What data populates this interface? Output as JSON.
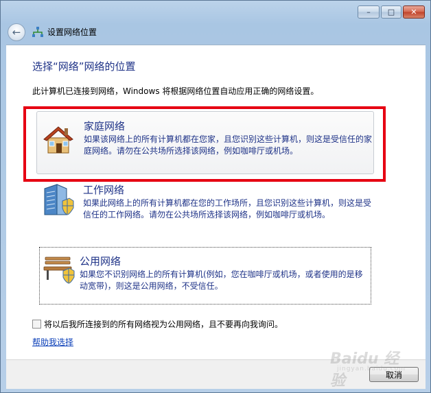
{
  "window": {
    "title": "设置网络位置",
    "controls": {
      "minimize": "–",
      "maximize": "□",
      "close": "✕"
    }
  },
  "content": {
    "heading": "选择“网络”网络的位置",
    "description": "此计算机已连接到网络，Windows 将根据网络位置自动应用正确的网络设置。",
    "options": [
      {
        "title": "家庭网络",
        "line1": "如果该网络上的所有计算机都在您家，且您识别这些计算机，则这是受信任的家",
        "line2": "庭网络。请勿在公共场所选择该网络，例如咖啡厅或机场。",
        "icon": "house-icon"
      },
      {
        "title": "工作网络",
        "line1": "如果此网络上的所有计算机都在您的工作场所，且您识别这些计算机，则这是受",
        "line2": "信任的工作网络。请勿在公共场所选择该网络，例如咖啡厅或机场。",
        "icon": "office-building-icon"
      },
      {
        "title": "公用网络",
        "line1": "如果您不识别网络上的所有计算机(例如，您在咖啡厅或机场，或者使用的是移",
        "line2": "动宽带)，则这是公用网络，不受信任。",
        "icon": "park-bench-icon"
      }
    ],
    "checkbox_label": "将以后我所连接到的所有网络视为公用网络，且不要再向我询问。",
    "checkbox_checked": false,
    "help_link": "帮助我选择"
  },
  "footer": {
    "cancel": "取消"
  },
  "watermark": {
    "main": "Baidu 经验",
    "sub": "jingyan.baidu.com"
  },
  "colors": {
    "accent_text": "#1e3287",
    "highlight_border": "#e60012",
    "link": "#0b3fb8"
  }
}
